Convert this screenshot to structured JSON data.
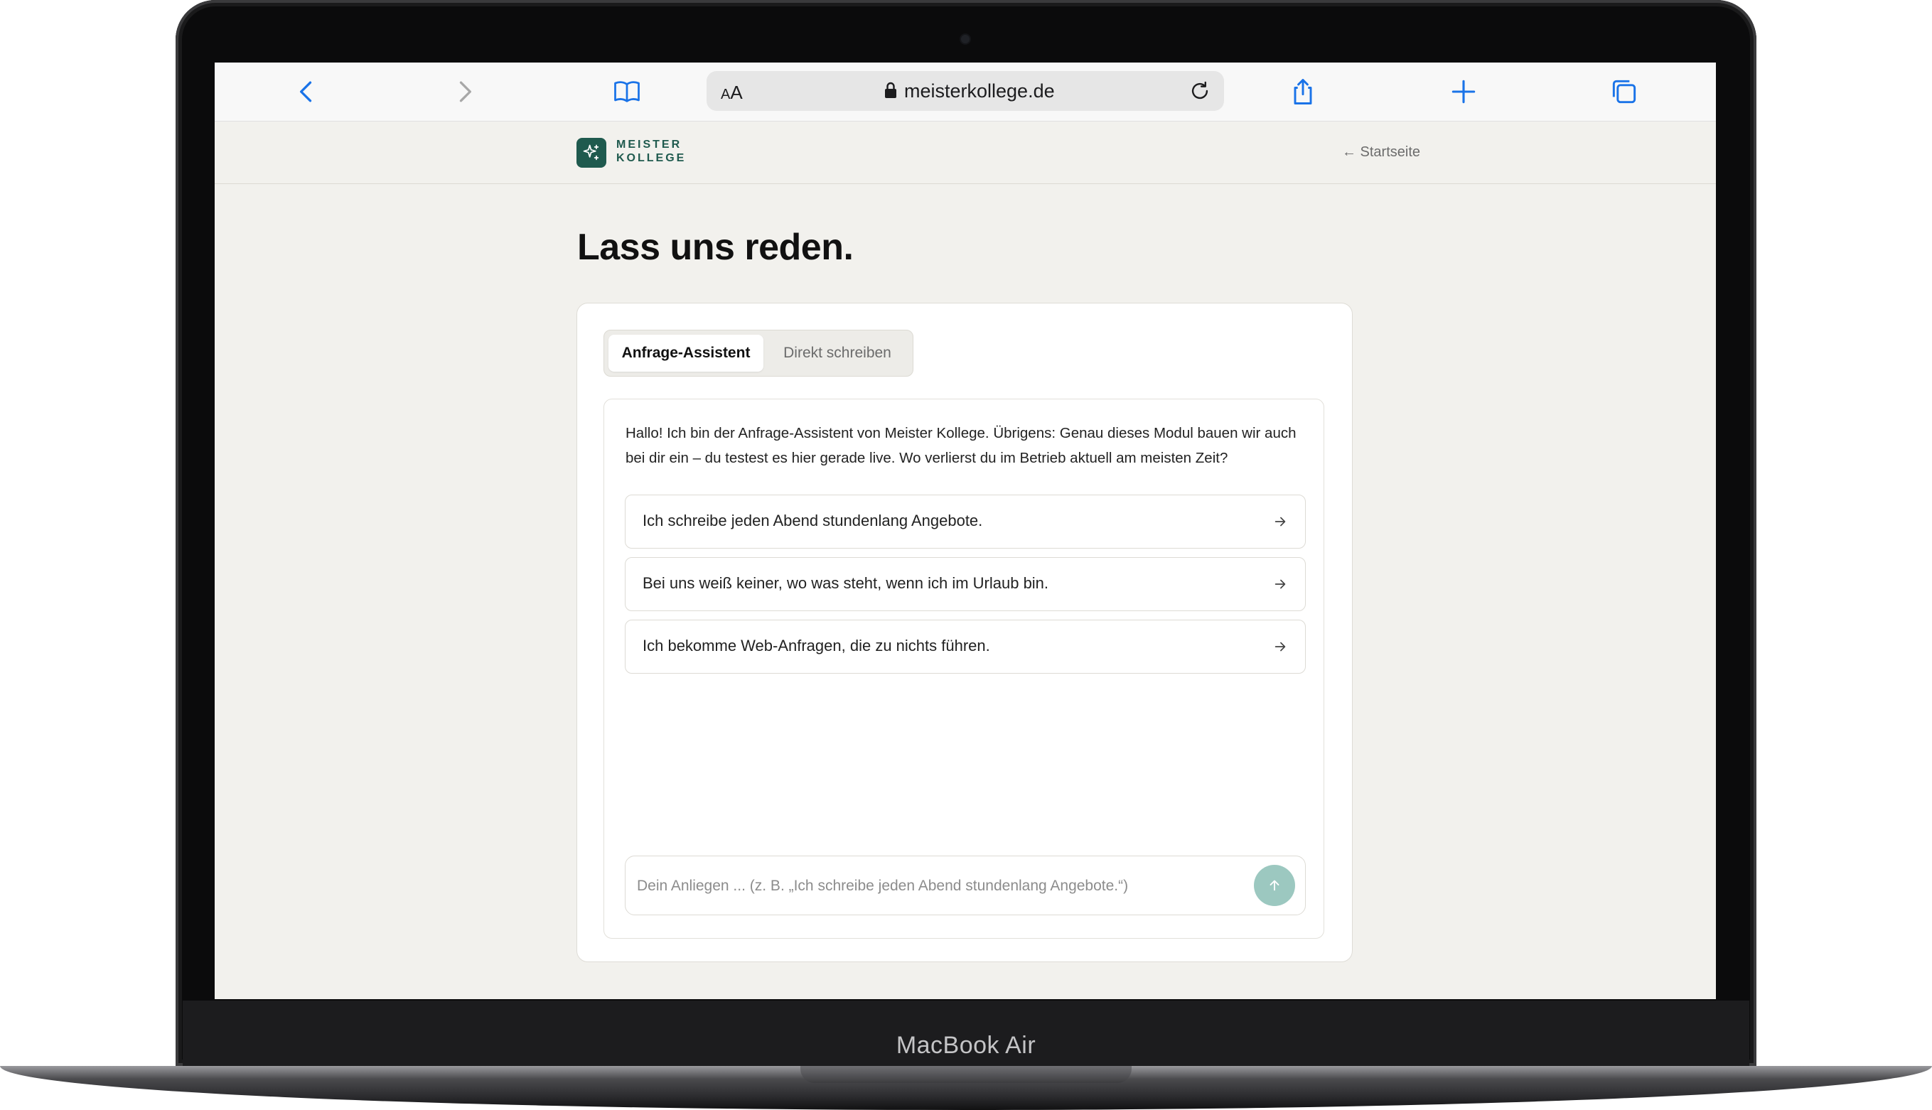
{
  "device": {
    "label": "MacBook Air"
  },
  "browser": {
    "url_aa_big": "A",
    "url_aa_small": "A",
    "url": "meisterkollege.de",
    "icons": [
      "back-icon",
      "forward-icon",
      "bookmarks-icon",
      "lock-icon",
      "reload-icon",
      "share-icon",
      "new-tab-icon",
      "tabs-icon"
    ]
  },
  "site": {
    "logo_line1": "MEISTER",
    "logo_line2": "KOLLEGE",
    "back_link": "← Startseite",
    "title": "Lass uns reden."
  },
  "tabs": [
    {
      "label": "Anfrage-Assistent",
      "active": true
    },
    {
      "label": "Direkt schreiben",
      "active": false
    }
  ],
  "chat": {
    "greeting": "Hallo! Ich bin der Anfrage-Assistent von Meister Kollege. Übrigens: Genau dieses Modul bauen wir auch bei dir ein – du testest es hier gerade live. Wo verlierst du im Betrieb aktuell am meisten Zeit?",
    "options": [
      "Ich schreibe jeden Abend stundenlang Angebote.",
      "Bei uns weiß keiner, wo was steht, wenn ich im Urlaub bin.",
      "Ich bekomme Web-Anfragen, die zu nichts führen."
    ],
    "input_placeholder": "Dein Anliegen ... (z. B. „Ich schreibe jeden Abend stundenlang Angebote.“)",
    "input_value": ""
  },
  "colors": {
    "accent": "#1f5a4e",
    "send_button": "#9cc8c0",
    "browser_blue": "#1a73e8",
    "page_bg": "#f2f1ed"
  }
}
